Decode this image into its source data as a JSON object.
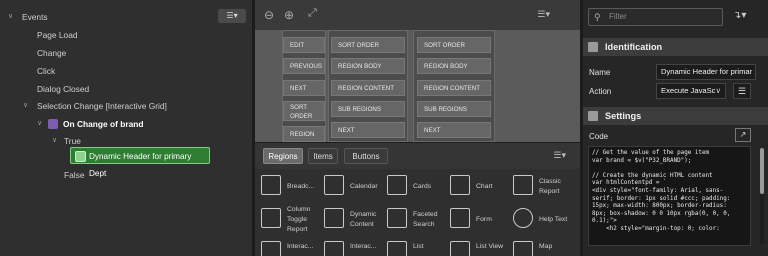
{
  "tree": {
    "root": "Events",
    "events": [
      "Page Load",
      "Change",
      "Click",
      "Dialog Closed"
    ],
    "selection_event": "Selection Change [Interactive Grid]",
    "dynamic_action": "On Change of brand",
    "true_label": "True",
    "selected_action": "Dynamic Header for primary Dept",
    "false_label": "False"
  },
  "layout_slots": {
    "col1": [
      "EDIT",
      "PREVIOUS",
      "NEXT",
      "SORT ORDER",
      "REGION"
    ],
    "col2": [
      "SORT ORDER",
      "REGION BODY",
      "REGION CONTENT",
      "SUB REGIONS",
      "NEXT"
    ],
    "col3": [
      "SORT ORDER",
      "REGION BODY",
      "REGION CONTENT",
      "SUB REGIONS",
      "NEXT"
    ]
  },
  "gallery": {
    "tabs": [
      "Regions",
      "Items",
      "Buttons"
    ],
    "active_tab": "Regions",
    "items": [
      [
        "Breadc...",
        "Calendar",
        "Cards",
        "Chart",
        "Classic Report"
      ],
      [
        "Column Toggle Report",
        "Dynamic Content",
        "Faceted Search",
        "Form",
        "Help Text"
      ],
      [
        "Interac...",
        "Interac...",
        "List",
        "List View",
        "Map"
      ]
    ]
  },
  "props": {
    "filter_placeholder": "Filter",
    "identification_title": "Identification",
    "name_label": "Name",
    "name_value": "Dynamic Header for primar",
    "action_label": "Action",
    "action_value": "Execute JavaSc",
    "settings_title": "Settings",
    "code_label": "Code",
    "code_lines": [
      "// Get the value of the page item",
      "var brand = $v(\"P32_BRAND\");",
      "",
      "// Create the dynamic HTML content",
      "var htmlContentpd = `",
      "<div style=\"font-family: Arial, sans-",
      "serif; border: 1px solid #ccc; padding:",
      "15px; max-width: 800px; border-radius:",
      "8px; box-shadow: 0 0 10px rgba(0, 0, 0,",
      "0.1);\">",
      "    <h2 style=\"margin-top: 0; color:"
    ]
  },
  "colors": {
    "selected_green": "#2e7d32",
    "da_purple": "#7b5cb0",
    "accent_blue": "#4aa3df"
  },
  "icons": [
    "menu-icon",
    "zoom-out-icon",
    "zoom-in-icon",
    "expand-icon",
    "search-icon",
    "return-icon",
    "list-icon",
    "expand-code-icon"
  ]
}
